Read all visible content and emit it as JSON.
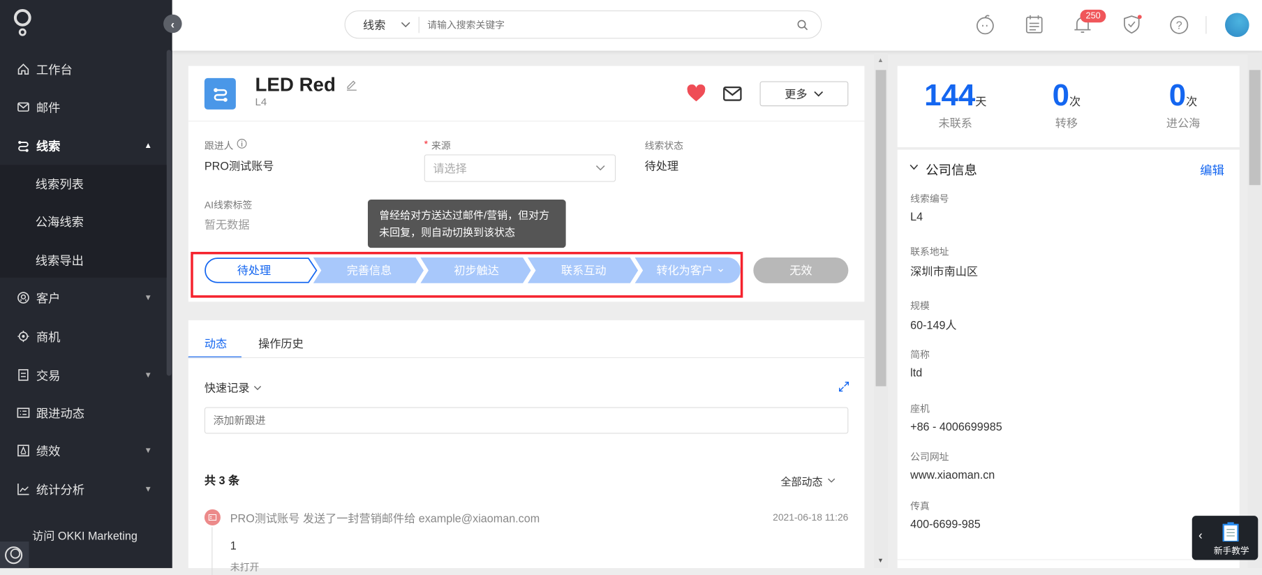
{
  "sidebar": {
    "items": [
      {
        "label": "工作台",
        "icon": "home-icon"
      },
      {
        "label": "邮件",
        "icon": "mail-icon"
      },
      {
        "label": "线索",
        "icon": "leads-icon",
        "expanded": true
      },
      {
        "label": "客户",
        "icon": "customer-icon"
      },
      {
        "label": "商机",
        "icon": "target-icon"
      },
      {
        "label": "交易",
        "icon": "document-icon"
      },
      {
        "label": "跟进动态",
        "icon": "list-icon"
      },
      {
        "label": "绩效",
        "icon": "performance-icon"
      },
      {
        "label": "统计分析",
        "icon": "chart-icon"
      }
    ],
    "subitems": [
      "线索列表",
      "公海线索",
      "线索导出"
    ],
    "marketing_link": "访问 OKKI Marketing"
  },
  "header": {
    "search_scope": "线索",
    "search_placeholder": "请输入搜索关键字",
    "notification_count": "250"
  },
  "lead": {
    "title": "LED Red",
    "code": "L4",
    "more_button": "更多",
    "fields": {
      "owner_label": "跟进人",
      "owner_value": "PRO测试账号",
      "source_label": "来源",
      "source_required": "*",
      "source_placeholder": "请选择",
      "status_label": "线索状态",
      "status_value": "待处理",
      "ai_tag_label": "AI线索标签",
      "ai_tag_value": "暂无数据"
    },
    "tooltip": "曾经给对方送达过邮件/营销，但对方未回复，则自动切换到该状态",
    "stages": [
      "待处理",
      "完善信息",
      "初步触达",
      "联系互动",
      "转化为客户"
    ],
    "current_stage": "待处理",
    "invalid_button": "无效"
  },
  "activity": {
    "tabs": [
      "动态",
      "操作历史"
    ],
    "active_tab": "动态",
    "quick_record": "快速记录",
    "input_placeholder": "添加新跟进",
    "total": "共 3 条",
    "filter": "全部动态",
    "items": [
      {
        "text": "PRO测试账号 发送了一封营销邮件给 example@xiaoman.com",
        "time": "2021-06-18 11:26",
        "body": "1",
        "status": "未打开"
      }
    ]
  },
  "stats": [
    {
      "value": "144",
      "unit": "天",
      "caption": "未联系"
    },
    {
      "value": "0",
      "unit": "次",
      "caption": "转移"
    },
    {
      "value": "0",
      "unit": "次",
      "caption": "进公海"
    }
  ],
  "company": {
    "title": "公司信息",
    "edit": "编辑",
    "fields": [
      {
        "label": "线索编号",
        "value": "L4"
      },
      {
        "label": "联系地址",
        "value": "深圳市南山区"
      },
      {
        "label": "规模",
        "value": "60-149人"
      },
      {
        "label": "简称",
        "value": "ltd"
      },
      {
        "label": "座机",
        "value": "+86 - 4006699985"
      },
      {
        "label": "公司网址",
        "value": "www.xiaoman.cn"
      },
      {
        "label": "传真",
        "value": "400-6699-985"
      }
    ]
  },
  "tutorial": {
    "label": "新手教学"
  },
  "colors": {
    "accent": "#1466f0",
    "stage_inactive": "#a8c8fb",
    "highlight_box": "#f5222d",
    "sidebar": "#252830"
  }
}
